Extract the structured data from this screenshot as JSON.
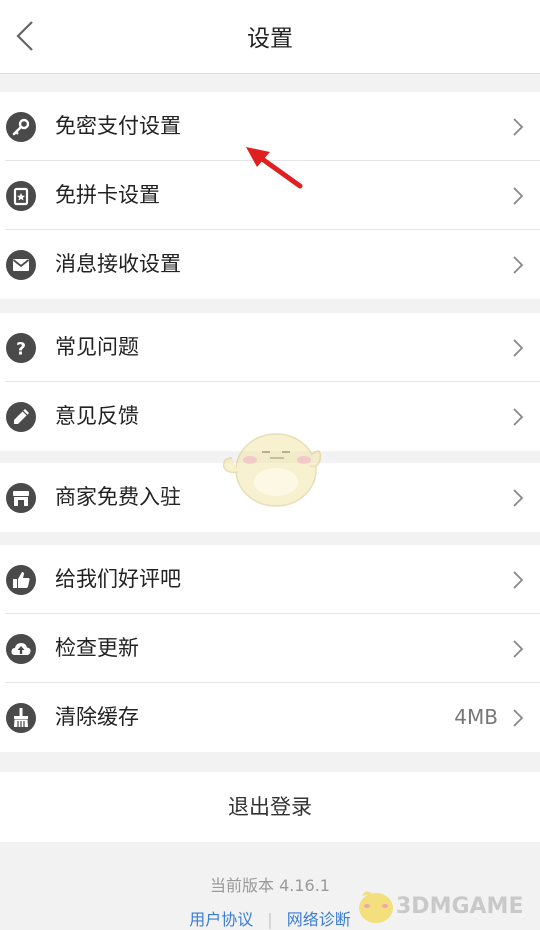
{
  "header": {
    "title": "设置",
    "back_icon": "chevron-left-icon"
  },
  "groups": [
    {
      "items": [
        {
          "label": "免密支付设置",
          "icon": "key-icon",
          "value": ""
        },
        {
          "label": "免拼卡设置",
          "icon": "card-icon",
          "value": ""
        },
        {
          "label": "消息接收设置",
          "icon": "envelope-icon",
          "value": ""
        }
      ]
    },
    {
      "items": [
        {
          "label": "常见问题",
          "icon": "question-icon",
          "value": ""
        },
        {
          "label": "意见反馈",
          "icon": "pencil-icon",
          "value": ""
        }
      ]
    },
    {
      "items": [
        {
          "label": "商家免费入驻",
          "icon": "store-icon",
          "value": ""
        }
      ]
    },
    {
      "items": [
        {
          "label": "给我们好评吧",
          "icon": "thumbs-up-icon",
          "value": ""
        },
        {
          "label": "检查更新",
          "icon": "cloud-upload-icon",
          "value": ""
        },
        {
          "label": "清除缓存",
          "icon": "broom-icon",
          "value": "4MB"
        }
      ]
    }
  ],
  "logout_label": "退出登录",
  "footer": {
    "version": "当前版本 4.16.1",
    "links": [
      "用户协议",
      "网络诊断"
    ],
    "separator": "|"
  },
  "watermark_text": "3DMGAME",
  "colors": {
    "icon": "#4a4a4a",
    "link": "#3b7dd8",
    "arrow": "#e02020",
    "background": "#f2f2f2"
  }
}
